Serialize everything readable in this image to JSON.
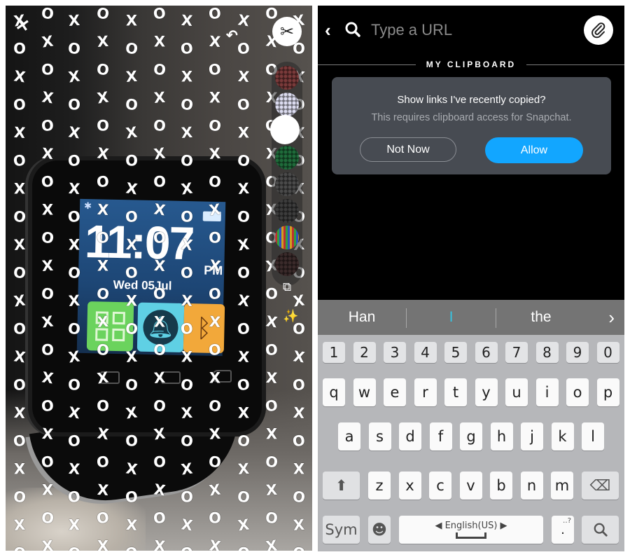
{
  "left_panel": {
    "watch": {
      "time": "11:07",
      "ampm": "PM",
      "date": "Wed 05Jul",
      "bluetooth_glyph": "✱",
      "apps": [
        "grid-apps-icon",
        "bell-icon",
        "bluetooth-icon"
      ]
    },
    "drawing_pattern": {
      "marks": [
        "X",
        "O"
      ],
      "color": "#ffffff"
    },
    "tools": {
      "close_glyph": "✕",
      "undo_glyph": "↶",
      "scissors_glyph": "✂",
      "sticker_glyph": "⧉",
      "magic_glyph": "✨",
      "brush_swatches": [
        "#7a3a3a",
        "#dcdcf0",
        "#ffffff",
        "#1f6b3a",
        "#4a4a4a",
        "#3c3c3c",
        "#7d3fa0",
        "#3a2a2a"
      ]
    }
  },
  "right_panel": {
    "search": {
      "placeholder": "Type a URL",
      "value": ""
    },
    "clipboard_header": "MY CLIPBOARD",
    "dialog": {
      "question": "Show links I've recently copied?",
      "subtitle": "This requires clipboard access for Snapchat.",
      "not_now_label": "Not Now",
      "allow_label": "Allow",
      "accent_color": "#12a6ff"
    },
    "keyboard": {
      "suggestions": [
        "Han",
        "I",
        "the"
      ],
      "suggestion_next": "›",
      "number_row": [
        "1",
        "2",
        "3",
        "4",
        "5",
        "6",
        "7",
        "8",
        "9",
        "0"
      ],
      "row1": [
        "q",
        "w",
        "e",
        "r",
        "t",
        "y",
        "u",
        "i",
        "o",
        "p"
      ],
      "row2": [
        "a",
        "s",
        "d",
        "f",
        "g",
        "h",
        "j",
        "k",
        "l"
      ],
      "row3": [
        "z",
        "x",
        "c",
        "v",
        "b",
        "n",
        "m"
      ],
      "shift_glyph": "⬆",
      "backspace_glyph": "⌫",
      "sym_label": "Sym",
      "emoji_glyph": "☻",
      "space_label": "English(US)",
      "space_left_arrow": "◀",
      "space_right_arrow": "▶",
      "period_label": ".",
      "period_hint": "‥?",
      "search_key_glyph": "⌕"
    }
  }
}
